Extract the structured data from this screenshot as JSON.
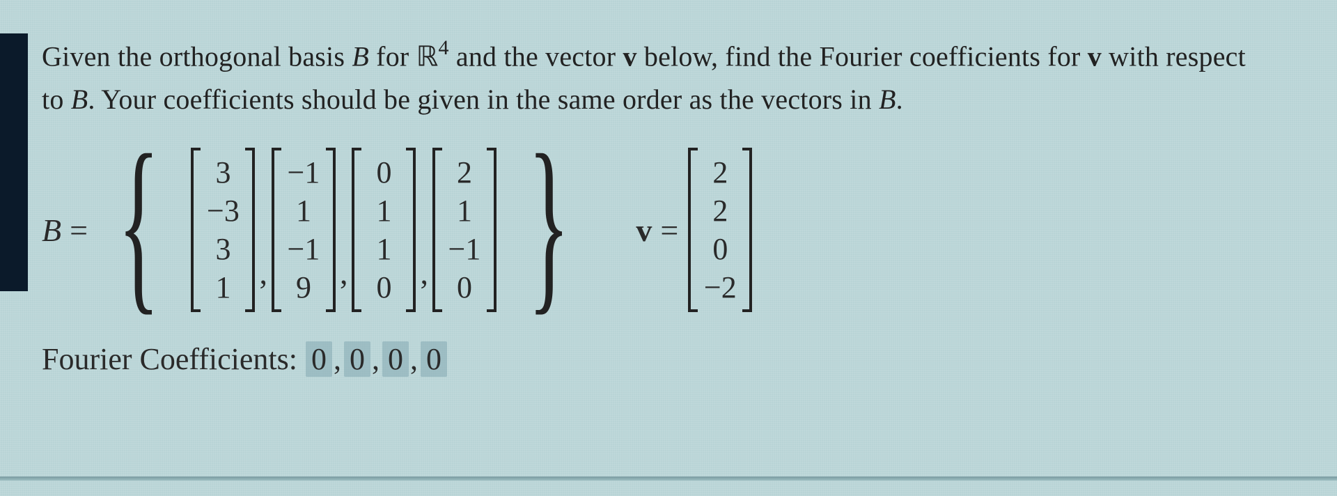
{
  "prompt": {
    "line1_a": "Given the orthogonal basis ",
    "B": "B",
    "line1_b": " for ",
    "R": "ℝ",
    "exp": "4",
    "line1_c": " and the vector ",
    "v": "v",
    "line1_d": " below, find the Fourier coefficients for ",
    "v2": "v",
    "line1_e": " with respect",
    "line2_a": "to ",
    "B2": "B",
    "line2_b": ". Your coefficients should be given in the same order as the vectors in ",
    "B3": "B",
    "line2_c": "."
  },
  "basis": {
    "label": "B",
    "eq": "=",
    "vectors": [
      [
        "3",
        "−3",
        "3",
        "1"
      ],
      [
        "−1",
        "1",
        "−1",
        "9"
      ],
      [
        "0",
        "1",
        "1",
        "0"
      ],
      [
        "2",
        "1",
        "−1",
        "0"
      ]
    ]
  },
  "vector": {
    "label": "v",
    "eq": "=",
    "entries": [
      "2",
      "2",
      "0",
      "−2"
    ]
  },
  "answer": {
    "label": "Fourier Coefficients:",
    "values": [
      "0",
      "0",
      "0",
      "0"
    ]
  },
  "chart_data": {
    "type": "table",
    "title": "Fourier coefficients problem data",
    "basis_vectors": [
      [
        3,
        -3,
        3,
        1
      ],
      [
        -1,
        1,
        -1,
        9
      ],
      [
        0,
        1,
        1,
        0
      ],
      [
        2,
        1,
        -1,
        0
      ]
    ],
    "v": [
      2,
      2,
      0,
      -2
    ],
    "answer_shown": [
      0,
      0,
      0,
      0
    ]
  }
}
